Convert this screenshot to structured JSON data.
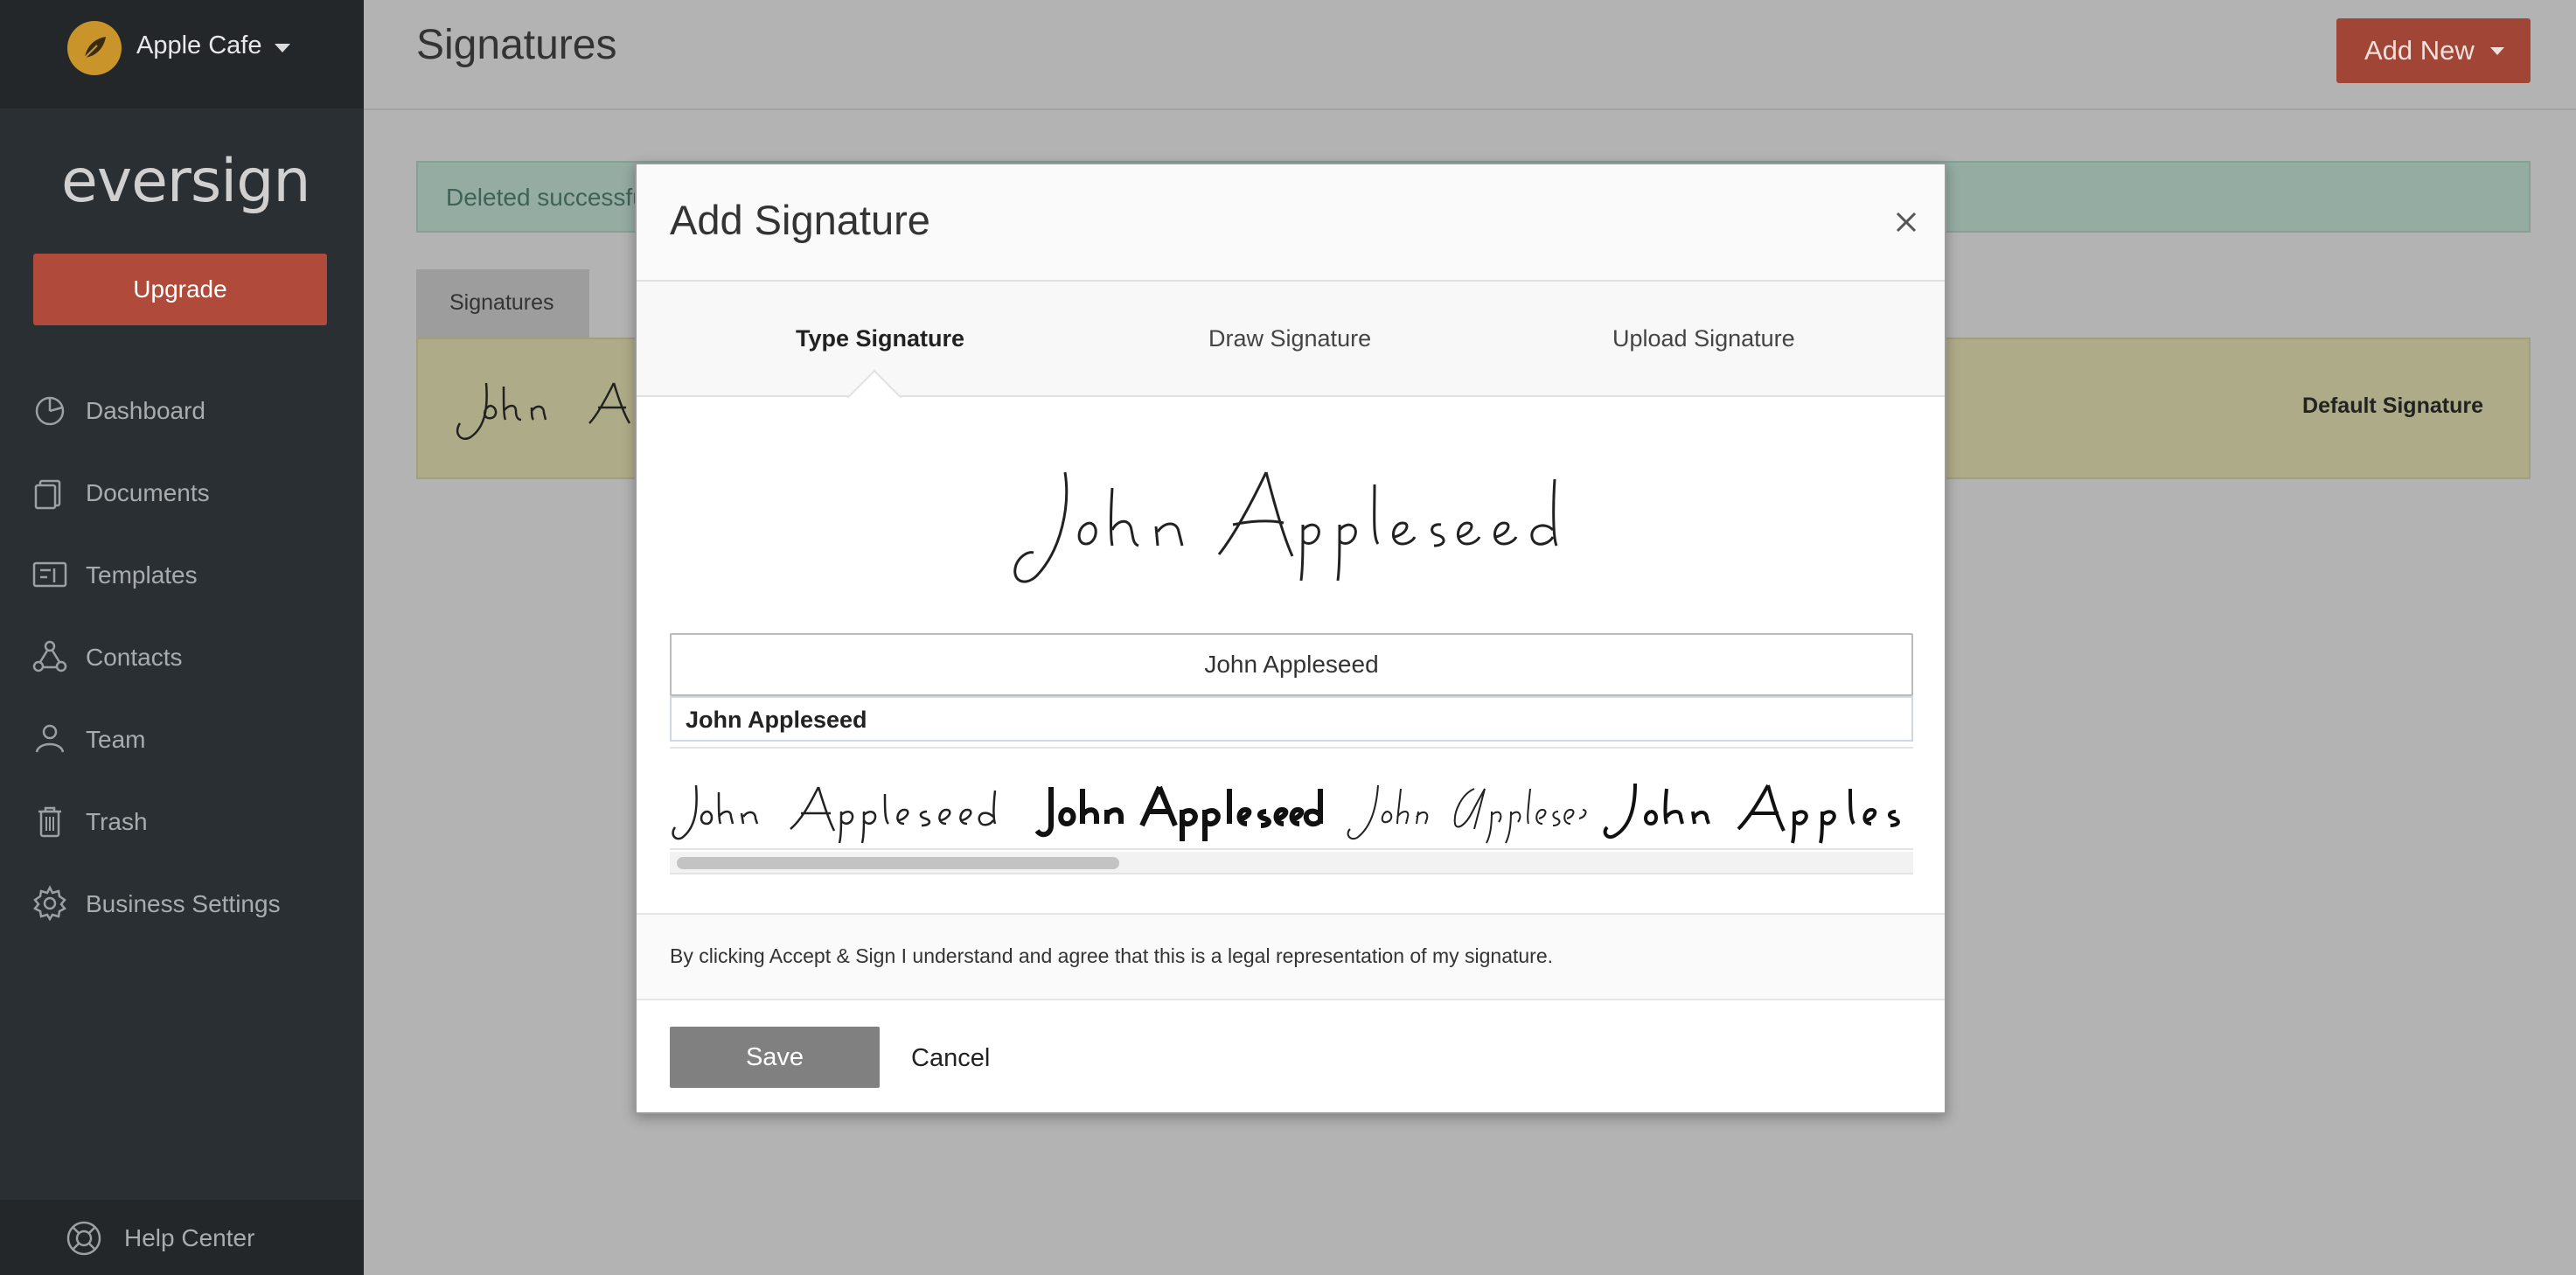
{
  "sidebar": {
    "company_name": "Apple Cafe",
    "brand": "eversign",
    "upgrade_label": "Upgrade",
    "items": [
      {
        "label": "Dashboard",
        "icon": "pie-chart-icon"
      },
      {
        "label": "Documents",
        "icon": "documents-icon"
      },
      {
        "label": "Templates",
        "icon": "templates-icon"
      },
      {
        "label": "Contacts",
        "icon": "contacts-icon"
      },
      {
        "label": "Team",
        "icon": "team-icon"
      },
      {
        "label": "Trash",
        "icon": "trash-icon"
      },
      {
        "label": "Business Settings",
        "icon": "gear-icon"
      }
    ],
    "help_label": "Help Center"
  },
  "header": {
    "title": "Signatures",
    "add_new_label": "Add New"
  },
  "alert": {
    "text": "Deleted successfu"
  },
  "signatures_tab": {
    "label": "Signatures"
  },
  "signature_row": {
    "default_label": "Default Signature"
  },
  "modal": {
    "title": "Add Signature",
    "tabs": [
      {
        "label": "Type Signature",
        "active": true
      },
      {
        "label": "Draw Signature",
        "active": false
      },
      {
        "label": "Upload Signature",
        "active": false
      }
    ],
    "preview_text": "John Appleseed",
    "input_value": "John Appleseed",
    "suggestion": "John Appleseed",
    "font_options": [
      "John Appleseed",
      "John Appleseed",
      "John Appleseed",
      "John Applese"
    ],
    "legal_text": "By clicking Accept & Sign I understand and agree that this is a legal representation of my signature.",
    "save_label": "Save",
    "cancel_label": "Cancel"
  },
  "colors": {
    "sidebar_bg": "#2a2f33",
    "upgrade": "#b04a3a",
    "add_new": "#a14536",
    "save": "#808080"
  }
}
